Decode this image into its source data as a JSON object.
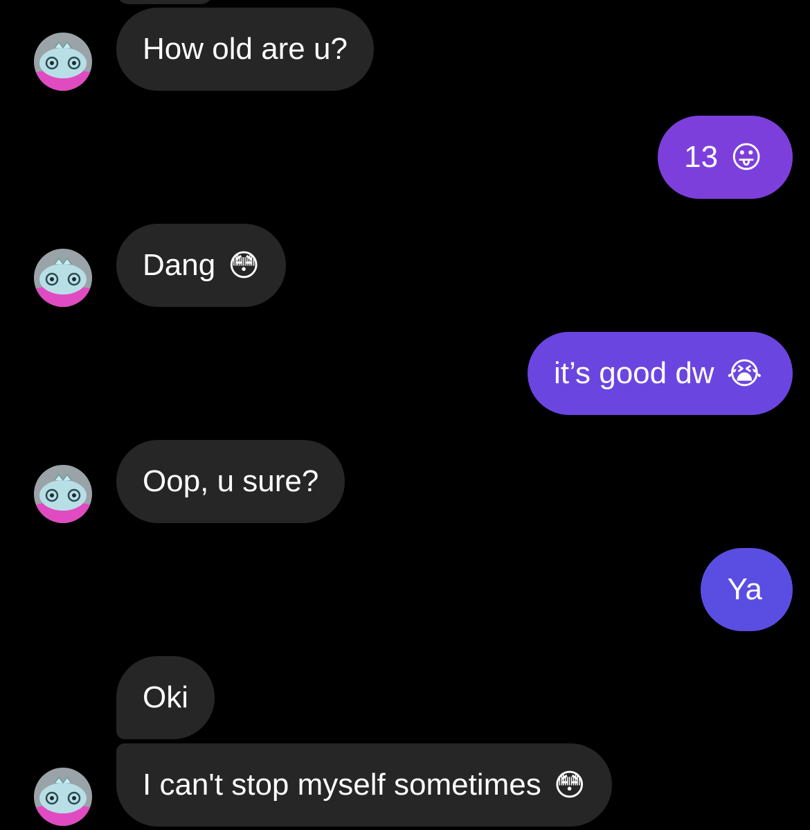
{
  "thread": {
    "messages": [
      {
        "id": "m1",
        "direction": "incoming",
        "text": "How old are u?",
        "emoji": ""
      },
      {
        "id": "m2",
        "direction": "outgoing",
        "text": "13",
        "emoji": "😛"
      },
      {
        "id": "m3",
        "direction": "incoming",
        "text": "Dang",
        "emoji": "😳"
      },
      {
        "id": "m4",
        "direction": "outgoing",
        "text": "it’s good dw",
        "emoji": "😭"
      },
      {
        "id": "m5",
        "direction": "incoming",
        "text": "Oop, u sure?",
        "emoji": ""
      },
      {
        "id": "m6",
        "direction": "outgoing",
        "text": "Ya",
        "emoji": ""
      },
      {
        "id": "m7",
        "direction": "incoming",
        "text": "Oki",
        "emoji": ""
      },
      {
        "id": "m8",
        "direction": "incoming",
        "text": "I can't stop myself sometimes",
        "emoji": "😳"
      }
    ]
  },
  "colors": {
    "background": "#000000",
    "incoming_bubble": "#262626",
    "outgoing_bubble_top": "#7d3fdc",
    "outgoing_bubble_mid": "#6b45e0",
    "outgoing_bubble_bottom": "#5a4ee2",
    "text": "#ffffff"
  },
  "icons": {
    "avatar": "cartoon-creature-avatar-icon"
  }
}
